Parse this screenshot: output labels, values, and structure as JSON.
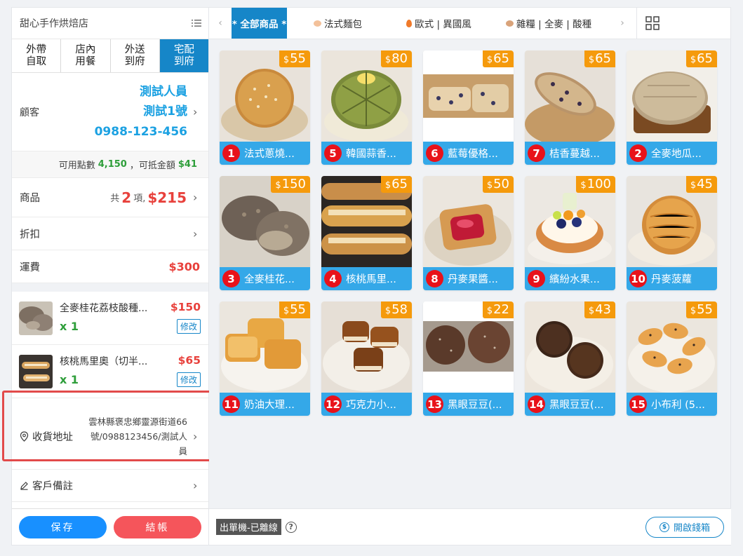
{
  "store": {
    "name": "甜心手作烘焙店"
  },
  "order_types": [
    {
      "label": "外帶\n自取",
      "active": false
    },
    {
      "label": "店內\n用餐",
      "active": false
    },
    {
      "label": "外送\n到府",
      "active": false
    },
    {
      "label": "宅配\n到府",
      "active": true
    }
  ],
  "customer": {
    "label": "顧客",
    "name_line1": "測試人員",
    "name_line2": "測試1號",
    "phone": "0988-123-456"
  },
  "points": {
    "available_label": "可用點數",
    "available": "4,150",
    "deductible_label": "，可抵金額",
    "deductible": "$41"
  },
  "goods": {
    "label": "商品",
    "count_prefix": "共",
    "count": "2",
    "count_suffix": "項,",
    "total": "$215"
  },
  "discount": {
    "label": "折扣"
  },
  "shipping": {
    "label": "運費",
    "amount": "$300"
  },
  "cart_items": [
    {
      "name": "全麥桂花荔枝酸種...",
      "qty": "x 1",
      "price": "$150",
      "edit_label": "修改"
    },
    {
      "name": "核桃馬里奧（切半...",
      "qty": "x 1",
      "price": "$65",
      "edit_label": "修改"
    }
  ],
  "address": {
    "label": "收貨地址",
    "text": "雲林縣褒忠鄉靈源街道66號/0988123456/測試人員"
  },
  "note": {
    "label": "客戶備註"
  },
  "buttons": {
    "save": "保存",
    "checkout": "結帳"
  },
  "tabs": [
    {
      "label": "* 全部商品 *",
      "active": true,
      "dot": ""
    },
    {
      "label": "法式麵包",
      "active": false,
      "dot": "#f3c19a"
    },
    {
      "label": "歐式 | 異國風",
      "active": false,
      "dot": "#f07a2a"
    },
    {
      "label": "雜糧 | 全麥 | 酸種",
      "active": false,
      "dot": "#d9a37a"
    }
  ],
  "products": [
    {
      "num": "1",
      "name": "法式蔥燒...",
      "price": "55"
    },
    {
      "num": "5",
      "name": "韓國蒜香...",
      "price": "80"
    },
    {
      "num": "6",
      "name": "藍莓優格...",
      "price": "65"
    },
    {
      "num": "7",
      "name": "桔香蔓越...",
      "price": "65"
    },
    {
      "num": "2",
      "name": "全麥地瓜...",
      "price": "65"
    },
    {
      "num": "3",
      "name": "全麥桂花...",
      "price": "150"
    },
    {
      "num": "4",
      "name": "核桃馬里...",
      "price": "65"
    },
    {
      "num": "8",
      "name": "丹麥果醬...",
      "price": "50"
    },
    {
      "num": "9",
      "name": "繽紛水果...",
      "price": "100"
    },
    {
      "num": "10",
      "name": "丹麥菠蘿",
      "price": "45"
    },
    {
      "num": "11",
      "name": "奶油大理...",
      "price": "55"
    },
    {
      "num": "12",
      "name": "巧克力小...",
      "price": "58"
    },
    {
      "num": "13",
      "name": "黑眼豆豆(...",
      "price": "22"
    },
    {
      "num": "14",
      "name": "黑眼豆豆(...",
      "price": "43"
    },
    {
      "num": "15",
      "name": "小布利 (5...",
      "price": "55"
    }
  ],
  "status": {
    "printer": "出單機-已離線",
    "help": "?",
    "drawer": "開啟錢箱"
  },
  "colors": {
    "accent": "#1686c8",
    "price_tag": "#f59a0c",
    "card_bar": "#34a8e8",
    "number_badge": "#e8121a",
    "highlight": "#e24a4a"
  }
}
